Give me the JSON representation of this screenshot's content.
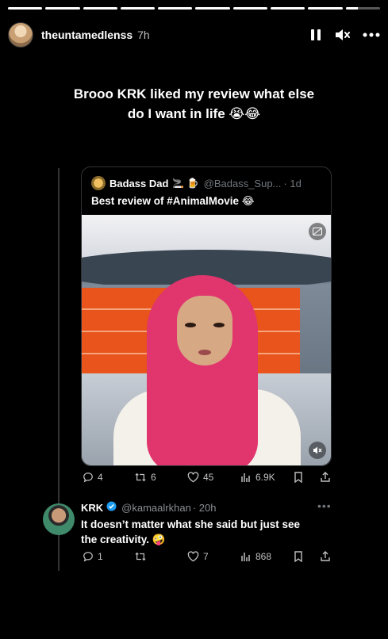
{
  "story": {
    "segments": 10,
    "segments_complete": 9,
    "username": "theuntamedlenss",
    "time": "7h",
    "caption_line1": "Brooo KRK liked my review what else",
    "caption_line2": "do I want in life 😭😂"
  },
  "icons": {
    "pause": "pause-icon",
    "mute": "mute-icon",
    "more": "more-icon"
  },
  "quoted_tweet": {
    "name": "Badass Dad",
    "name_emojis": "🚬 🍺",
    "handle": "@Badass_Sup...",
    "age": "· 1d",
    "text": "Best review of #AnimalMovie 😂",
    "stats": {
      "replies": "4",
      "reposts": "6",
      "likes": "45",
      "views": "6.9K"
    }
  },
  "reply_tweet": {
    "name": "KRK",
    "handle": "@kamaalrkhan",
    "age": "· 20h",
    "more": "•••",
    "text": "It doesn’t matter what she said but just see the creativity. 🤪",
    "stats": {
      "replies": "1",
      "reposts": "",
      "likes": "7",
      "views": "868"
    }
  },
  "colors": {
    "background": "#000000",
    "verified": "#1d9bf0",
    "muted_text": "#71767b"
  }
}
